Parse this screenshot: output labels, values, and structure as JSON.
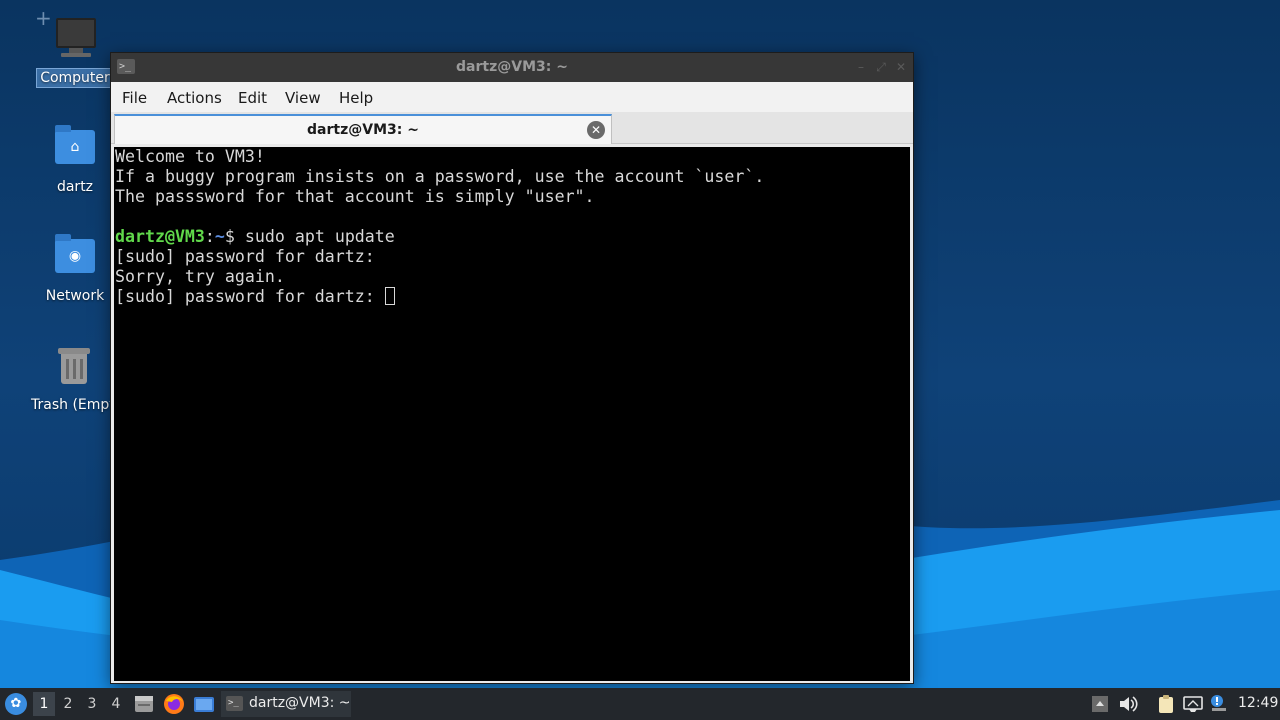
{
  "desktop": {
    "add_icon": "plus-icon",
    "icons": [
      {
        "label": "Computer",
        "icon": "computer-icon"
      },
      {
        "label": "dartz",
        "icon": "home-folder-icon"
      },
      {
        "label": "Network",
        "icon": "network-folder-icon"
      },
      {
        "label": "Trash (Empt",
        "icon": "trash-icon"
      }
    ]
  },
  "window": {
    "title": "dartz@VM3: ~",
    "app_icon_glyph": ">_",
    "controls": {
      "minimize": "–",
      "maximize": "⤢",
      "close": "✕"
    },
    "menu": [
      "File",
      "Actions",
      "Edit",
      "View",
      "Help"
    ],
    "tab": {
      "title": "dartz@VM3: ~",
      "close": "✕"
    }
  },
  "terminal": {
    "lines": [
      "Welcome to VM3!",
      "If a buggy program insists on a password, use the account `user`.",
      "The passsword for that account is simply \"user\".",
      ""
    ],
    "prompt": {
      "user_host": "dartz@VM3",
      "sep": ":",
      "path": "~",
      "symbol": "$",
      "command": " sudo apt update"
    },
    "output": [
      "[sudo] password for dartz:",
      "Sorry, try again.",
      "[sudo] password for dartz: "
    ]
  },
  "taskbar": {
    "menu_icon": "whisker-menu-icon",
    "workspaces": [
      "1",
      "2",
      "3",
      "4"
    ],
    "active_workspace": "1",
    "launchers": [
      "file-manager-icon",
      "firefox-icon",
      "show-desktop-icon"
    ],
    "task": {
      "label": "dartz@VM3: ~",
      "icon": "terminal-icon"
    },
    "tray": [
      "tray-expand-icon",
      "volume-icon",
      "clipboard-icon",
      "network-icon",
      "notification-icon"
    ],
    "clock": "12:49"
  },
  "colors": {
    "prompt_user": "#61d94b",
    "prompt_path": "#5a8ce0",
    "desktop_accent": "#1a9cf0"
  }
}
